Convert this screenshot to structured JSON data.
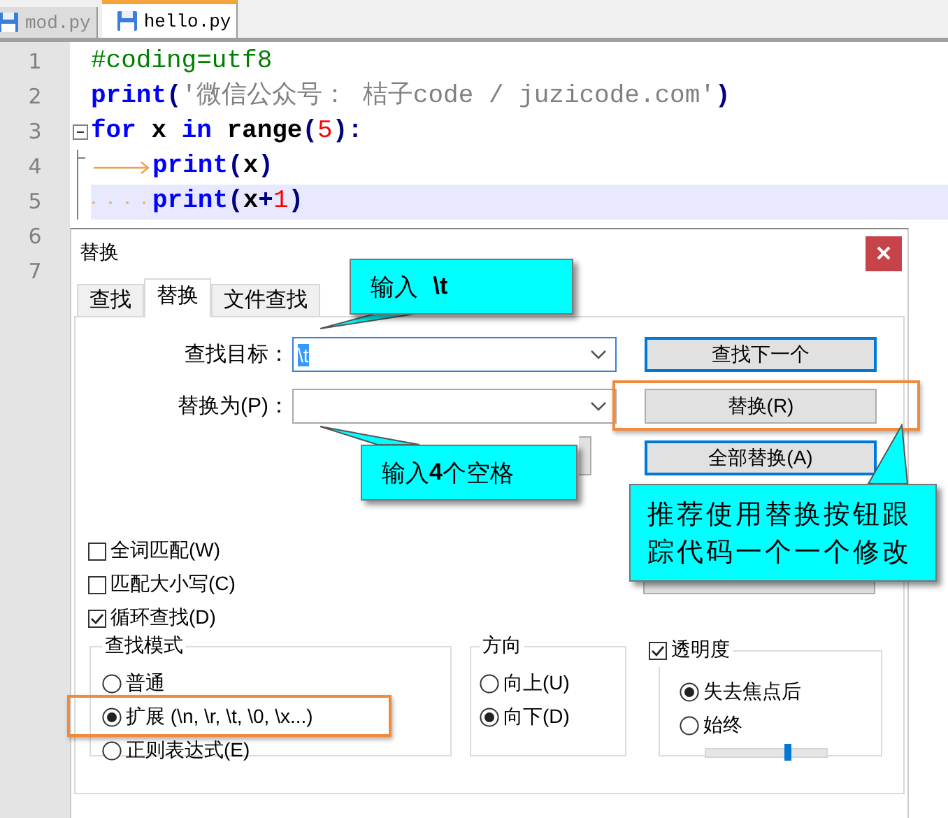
{
  "editor_tabs": [
    {
      "label": "mod.py",
      "selected": false
    },
    {
      "label": "hello.py",
      "selected": true
    }
  ],
  "code_lines": [
    {
      "number": "1",
      "current": false,
      "tokens": [
        {
          "kind": "comment",
          "text": "#coding=utf8"
        }
      ]
    },
    {
      "number": "2",
      "current": false,
      "tokens": [
        {
          "kind": "keyword",
          "text": "print"
        },
        {
          "kind": "operator",
          "text": "("
        },
        {
          "kind": "string",
          "text": "'微信公众号： 桔子code / juzicode.com'"
        },
        {
          "kind": "operator",
          "text": ")"
        }
      ]
    },
    {
      "number": "3",
      "current": false,
      "tokens": [
        {
          "kind": "keyword",
          "text": "for"
        },
        {
          "kind": "plain",
          "text": " x "
        },
        {
          "kind": "keyword",
          "text": "in"
        },
        {
          "kind": "plain",
          "text": " range"
        },
        {
          "kind": "operator",
          "text": "("
        },
        {
          "kind": "number",
          "text": "5"
        },
        {
          "kind": "operator",
          "text": "):"
        }
      ],
      "children": [
        {
          "number": "4",
          "current": false,
          "tokens": [
            {
              "kind": "tab"
            },
            {
              "kind": "keyword",
              "text": "print"
            },
            {
              "kind": "operator",
              "text": "("
            },
            {
              "kind": "plain",
              "text": "x"
            },
            {
              "kind": "operator",
              "text": ")"
            }
          ]
        },
        {
          "number": "5",
          "current": true,
          "tokens": [
            {
              "kind": "spaces"
            },
            {
              "kind": "keyword",
              "text": "print"
            },
            {
              "kind": "operator",
              "text": "("
            },
            {
              "kind": "plain",
              "text": "x"
            },
            {
              "kind": "operator",
              "text": "+"
            },
            {
              "kind": "number",
              "text": "1"
            },
            {
              "kind": "operator",
              "text": ")"
            }
          ]
        }
      ]
    },
    {
      "number": "6"
    },
    {
      "number": "7"
    }
  ],
  "dialog": {
    "title": "替换",
    "tabs": [
      {
        "label": "查找",
        "selected": false
      },
      {
        "label": "替换",
        "selected": true
      },
      {
        "label": "文件查找",
        "selected": false
      }
    ],
    "fields": [
      {
        "label": "查找目标：",
        "value": "\\t"
      },
      {
        "label": "替换为(P)："
      }
    ],
    "buttons": [
      {
        "label": "查找下一个",
        "focused": true
      },
      {
        "label": "替换(R)",
        "focused": false
      },
      {
        "label": "全部替换(A)",
        "focused": true
      }
    ],
    "options": [
      {
        "label": "全词匹配(W)",
        "checked": false
      },
      {
        "label": "匹配大小写(C)",
        "checked": false
      },
      {
        "label": "循环查找(D)",
        "checked": true
      }
    ],
    "search_mode": {
      "title": "查找模式",
      "options": [
        {
          "label": "普通",
          "selected": false
        },
        {
          "label": "扩展 (\\n, \\r, \\t, \\0, \\x...)",
          "selected": true
        },
        {
          "label": "正则表达式(E)",
          "selected": false
        }
      ]
    },
    "direction": {
      "title": "方向",
      "options": [
        {
          "label": "向上(U)",
          "selected": false
        },
        {
          "label": "向下(D)",
          "selected": true
        }
      ]
    },
    "transparency": {
      "label": "透明度",
      "checked": true,
      "options": [
        {
          "label": "失去焦点后",
          "selected": true
        },
        {
          "label": "始终",
          "selected": false
        }
      ],
      "slider": {
        "level": 0.67
      }
    }
  },
  "callouts": [
    {
      "text": "输入 **\\t**"
    },
    {
      "text": "输入**4**个空格"
    },
    {
      "text": "推荐使用替换按钮跟踪代码一个一个修改"
    }
  ]
}
